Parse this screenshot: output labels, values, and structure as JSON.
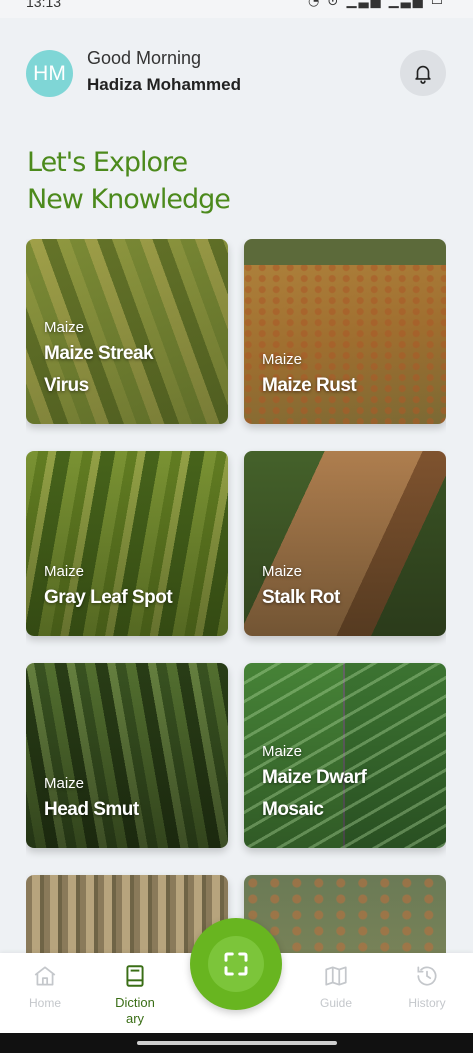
{
  "status_bar": {
    "time": "13:13",
    "icons": "◔ ⊙ ▁▃▅ ▁▃▅ ▭"
  },
  "user": {
    "initials": "HM",
    "greeting": "Good Morning",
    "name": "Hadiza Mohammed"
  },
  "headline": {
    "line1": "Let's Explore",
    "line2": "New Knowledge"
  },
  "cards": [
    {
      "category": "Maize",
      "title_lines": [
        "Maize Streak",
        "Virus"
      ]
    },
    {
      "category": "Maize",
      "title_lines": [
        "Maize Rust"
      ]
    },
    {
      "category": "Maize",
      "title_lines": [
        "Gray Leaf Spot"
      ]
    },
    {
      "category": "Maize",
      "title_lines": [
        "Stalk Rot"
      ]
    },
    {
      "category": "Maize",
      "title_lines": [
        "Head Smut"
      ]
    },
    {
      "category": "Maize",
      "title_lines": [
        "Maize Dwarf",
        "Mosaic"
      ]
    }
  ],
  "nav": {
    "home": "Home",
    "dictionary": "Diction ary",
    "guide": "Guide",
    "history": "History",
    "active": "dictionary"
  },
  "colors": {
    "accent_green": "#4c8a1c",
    "scan_button": "#68b520",
    "avatar_bg": "#7fd6d6"
  },
  "icons": {
    "bell": "bell-icon",
    "home": "home-icon",
    "dictionary": "book-icon",
    "scan": "scan-icon",
    "guide": "map-icon",
    "history": "history-icon"
  }
}
